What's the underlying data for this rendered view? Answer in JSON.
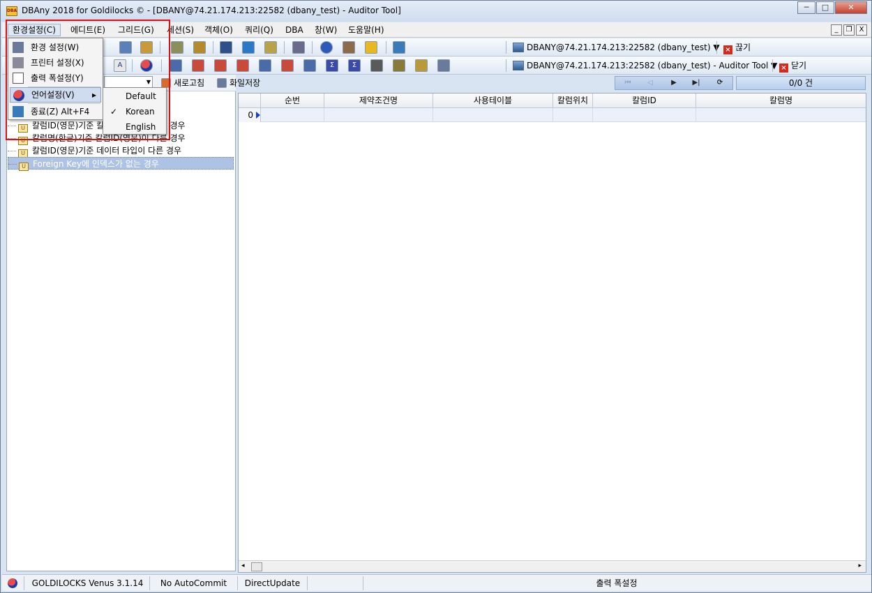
{
  "window": {
    "title": "DBAny 2018 for Goldilocks © - [DBANY@74.21.174.213:22582 (dbany_test) - Auditor Tool]",
    "app_icon_text": "DBA",
    "minimize": "─",
    "maximize": "□",
    "close": "✕"
  },
  "menubar": {
    "items": [
      {
        "label": "환경설정(C)"
      },
      {
        "label": "에디트(E)"
      },
      {
        "label": "그리드(G)"
      },
      {
        "label": "세션(S)"
      },
      {
        "label": "객체(O)"
      },
      {
        "label": "쿼리(Q)"
      },
      {
        "label": "DBA"
      },
      {
        "label": "창(W)"
      },
      {
        "label": "도움말(H)"
      }
    ],
    "mdi_min": "_",
    "mdi_restore": "❐",
    "mdi_close": "X"
  },
  "toolbar1": {
    "connection": "DBANY@74.21.174.213:22582 (dbany_test) ▼",
    "disconnect_label": "끊기"
  },
  "toolbar2": {
    "connection": "DBANY@74.21.174.213:22582 (dbany_test) - Auditor Tool ▼",
    "close_label": "닫기"
  },
  "actions": {
    "refresh": "새로고침",
    "save_file": "화일저장"
  },
  "navigator": {
    "first": "⏮",
    "prev": "◁",
    "next": "▶",
    "last": "▶|",
    "refresh": "⟳",
    "count": "0/0 건"
  },
  "tree": {
    "items": [
      {
        "label": "칼럼ID(영문)기준 칼럼명(한글)이 다른 경우"
      },
      {
        "label": "칼럼명(한글)기준 칼럼ID(영문)이 다른 경우"
      },
      {
        "label": "칼럼ID(영문)기준 데이터 타입이 다른 경우"
      },
      {
        "label": "Foreign Key에 인덱스가 없는 경우",
        "selected": true
      }
    ]
  },
  "grid": {
    "columns": [
      "순번",
      "제약조건명",
      "사용테이블",
      "칼럼위치",
      "칼럼ID",
      "칼럼명"
    ],
    "row_indicator": "0"
  },
  "dropdown": {
    "items": [
      {
        "label": "환경 설정(W)"
      },
      {
        "label": "프린터 설정(X)"
      },
      {
        "label": "출력 폭설정(Y)"
      },
      {
        "label": "언어설정(V)"
      },
      {
        "label": "종료(Z)  Alt+F4"
      }
    ],
    "submenu_arrow": "▸"
  },
  "submenu": {
    "items": [
      {
        "label": "Default"
      },
      {
        "label": "Korean",
        "checked": true
      },
      {
        "label": "English"
      }
    ],
    "check": "✓"
  },
  "statusbar": {
    "db_version": "GOLDILOCKS Venus 3.1.14",
    "commit_mode": "No AutoCommit",
    "update_mode": "DirectUpdate",
    "output": "출력 폭설정"
  },
  "colors": {
    "highlight_box": "#e01010",
    "selected_row": "#aec2e6"
  }
}
